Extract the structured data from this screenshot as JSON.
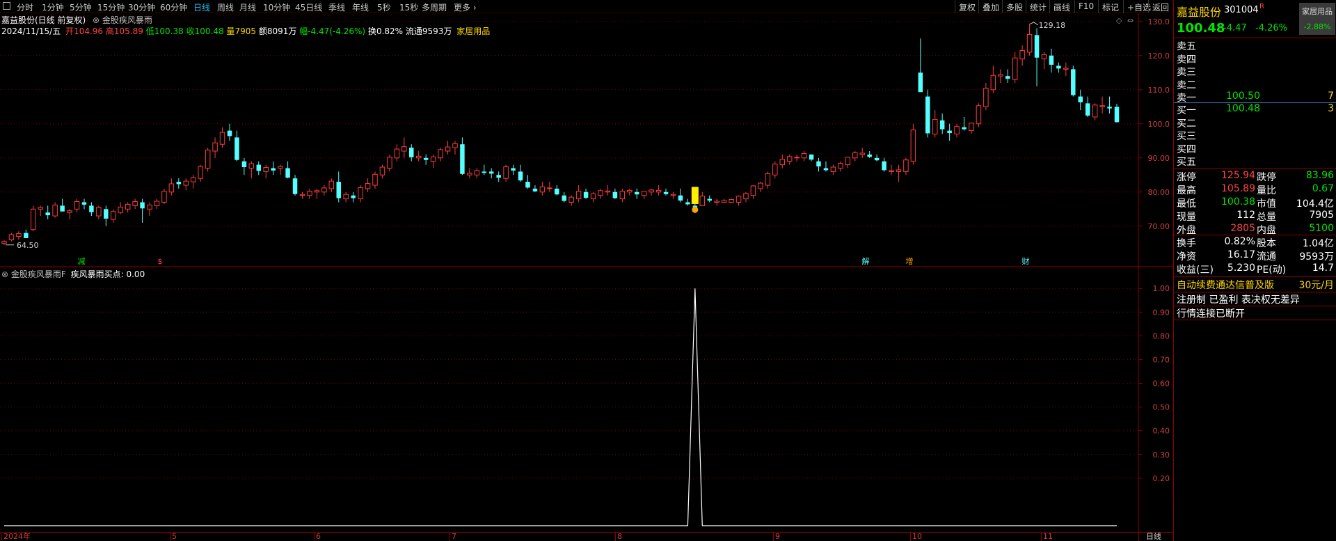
{
  "toolbar": {
    "periods": [
      "分时",
      "1分钟",
      "5分钟",
      "15分钟",
      "30分钟",
      "60分钟",
      "日线",
      "周线",
      "月线",
      "10分钟",
      "45日线",
      "季线",
      "年线",
      "5秒",
      "15秒",
      "多周期",
      "更多 ›"
    ],
    "active_period": "日线",
    "right_buttons": [
      "复权",
      "叠加",
      "多股",
      "统计",
      "画线",
      "F10",
      "标记",
      "+自选",
      "返回"
    ]
  },
  "info": {
    "title": "嘉益股份(日线 前复权)",
    "indicator_tag": "金股疾风暴雨",
    "date": "2024/11/15/五",
    "open_label": "开",
    "open": "104.96",
    "high_label": "高",
    "high": "105.89",
    "low_label": "低",
    "low": "100.38",
    "close_label": "收",
    "close": "100.48",
    "vol_label": "量",
    "vol": "7905",
    "amount_label": "额",
    "amount": "8091万",
    "chg_label": "幅",
    "chg": "-4.47(-4.26%)",
    "turnover_label": "换",
    "turnover": "0.82%",
    "float_label": "流通",
    "float": "9593万",
    "sector": "家居用品"
  },
  "main_chart": {
    "y_ticks": [
      "130.0",
      "120.0",
      "110.0",
      "100.0",
      "90.00",
      "80.00",
      "70.00"
    ],
    "y_range": [
      62,
      132
    ],
    "high_mark": "129.18",
    "low_mark": "64.50",
    "event_markers": [
      "减",
      "$",
      "解",
      "增",
      "财"
    ]
  },
  "indicator": {
    "name": "金股疾风暴雨F",
    "series_label": "疾风暴雨买点: 0.00",
    "y_ticks": [
      "1.00",
      "0.90",
      "0.80",
      "0.70",
      "0.60",
      "0.50",
      "0.40",
      "0.30",
      "0.20"
    ]
  },
  "time_axis": {
    "labels": [
      "2024年",
      "5",
      "6",
      "7",
      "8",
      "9",
      "10",
      "11"
    ],
    "period_tag": "日线"
  },
  "chart_data": {
    "type": "candlestick",
    "title": "嘉益股份(日线 前复权)",
    "candles": [
      [
        65,
        66,
        64.5,
        65.5
      ],
      [
        66,
        68,
        65.5,
        67.5
      ],
      [
        67,
        68.5,
        66,
        67.8
      ],
      [
        68,
        69,
        67,
        66.5
      ],
      [
        69,
        76,
        68.5,
        75
      ],
      [
        75,
        76,
        73,
        75.5
      ],
      [
        74,
        76,
        72,
        73.2
      ],
      [
        73,
        77,
        72.5,
        76.2
      ],
      [
        76,
        78,
        75,
        74.3
      ],
      [
        74,
        75,
        72,
        74.5
      ],
      [
        75,
        78,
        74,
        77.2
      ],
      [
        77,
        78,
        75,
        76.3
      ],
      [
        76,
        77,
        73,
        74.1
      ],
      [
        73,
        76,
        72,
        75.5
      ],
      [
        75,
        76,
        70,
        72.2
      ],
      [
        72,
        75,
        71,
        74.3
      ],
      [
        74,
        77,
        73.5,
        75.6
      ],
      [
        75,
        77,
        74,
        76.4
      ],
      [
        76,
        78,
        75,
        77.2
      ],
      [
        77,
        78,
        71,
        75.2
      ],
      [
        75,
        77,
        73,
        76.2
      ],
      [
        76,
        78,
        75,
        77.3
      ],
      [
        77,
        81,
        76.5,
        80.2
      ],
      [
        80,
        84,
        79,
        82.4
      ],
      [
        83,
        84,
        81,
        82.3
      ],
      [
        82,
        84,
        80.5,
        83.2
      ],
      [
        83,
        85,
        81,
        84.2
      ],
      [
        84,
        88,
        83,
        87.5
      ],
      [
        87,
        93,
        86,
        92.3
      ],
      [
        92,
        96,
        90,
        94.4
      ],
      [
        94,
        99,
        93,
        97.5
      ],
      [
        98,
        100,
        95,
        96.4
      ],
      [
        96,
        98,
        89,
        89.4
      ],
      [
        89,
        90,
        85,
        87.3
      ],
      [
        87,
        89,
        84,
        88.3
      ],
      [
        88,
        89,
        85,
        86.2
      ],
      [
        86,
        88,
        84,
        87.2
      ],
      [
        87,
        89,
        85,
        86.3
      ],
      [
        87,
        88,
        85,
        87.5
      ],
      [
        87,
        89,
        84,
        84.2
      ],
      [
        84,
        85,
        79,
        79.4
      ],
      [
        79,
        80,
        78,
        79.3
      ],
      [
        79,
        81,
        78,
        80.2
      ],
      [
        80,
        81,
        78,
        80.4
      ],
      [
        80,
        82,
        79,
        81.2
      ],
      [
        81,
        84,
        80,
        83.2
      ],
      [
        83,
        86,
        77,
        78.2
      ],
      [
        78,
        80,
        77,
        79.3
      ],
      [
        79,
        80,
        77,
        78.2
      ],
      [
        78,
        82,
        77,
        81.3
      ],
      [
        81,
        84,
        80,
        82.5
      ],
      [
        82,
        86,
        81,
        85.2
      ],
      [
        85,
        88,
        84,
        87.3
      ],
      [
        87,
        91,
        86,
        90.2
      ],
      [
        90,
        94,
        89,
        92.6
      ],
      [
        92,
        96,
        90,
        93.3
      ],
      [
        93,
        94,
        89,
        90.2
      ],
      [
        90,
        92,
        89,
        90.5
      ],
      [
        90,
        91,
        88,
        89.4
      ],
      [
        89,
        91,
        87,
        90.3
      ],
      [
        90,
        93,
        89,
        92.4
      ],
      [
        92,
        95,
        91,
        93.2
      ],
      [
        93,
        95,
        91,
        94.2
      ],
      [
        94,
        96,
        85,
        85.3
      ],
      [
        85,
        87,
        84,
        85.5
      ],
      [
        85,
        87,
        84,
        86.3
      ],
      [
        86,
        88,
        85,
        85.6
      ],
      [
        86,
        87,
        84,
        85.4
      ],
      [
        85,
        86,
        83,
        84.2
      ],
      [
        84,
        88,
        83,
        87.4
      ],
      [
        87,
        88,
        85,
        86.3
      ],
      [
        86,
        88,
        83,
        83.4
      ],
      [
        83,
        85,
        81,
        81.3
      ],
      [
        81,
        82,
        80,
        80.2
      ],
      [
        80,
        83,
        79,
        81.5
      ],
      [
        81,
        83,
        80,
        81.2
      ],
      [
        81,
        82,
        79,
        79.3
      ],
      [
        79,
        80,
        77,
        77.4
      ],
      [
        77,
        79,
        76,
        78.5
      ],
      [
        78,
        82,
        77,
        80.2
      ],
      [
        80,
        81,
        78,
        78.3
      ],
      [
        78,
        80,
        77,
        79.5
      ],
      [
        79,
        81,
        78,
        80.4
      ],
      [
        80,
        82,
        79,
        80.3
      ],
      [
        80,
        81,
        78,
        78.2
      ],
      [
        78,
        81,
        77,
        80.2
      ],
      [
        80,
        81,
        79,
        80.5
      ],
      [
        80,
        81,
        78,
        79.3
      ],
      [
        79,
        80,
        78,
        80.2
      ],
      [
        80,
        81,
        79,
        80.6
      ],
      [
        80,
        82,
        79,
        80.5
      ],
      [
        80,
        81,
        79,
        79.4
      ],
      [
        79,
        80,
        78,
        79.3
      ],
      [
        79,
        81,
        77,
        77.5
      ],
      [
        77,
        78,
        76,
        76.4
      ],
      [
        76,
        77,
        75,
        75.5
      ],
      [
        76,
        80,
        76,
        78.8
      ],
      [
        78,
        79,
        77,
        77.5
      ],
      [
        77,
        78,
        76,
        77.3
      ],
      [
        77,
        78,
        77,
        77.5
      ],
      [
        77,
        78,
        77,
        77.8
      ],
      [
        77,
        79,
        76,
        78.8
      ],
      [
        78,
        80,
        77,
        79.6
      ],
      [
        79,
        82,
        78,
        81.8
      ],
      [
        81,
        83,
        80,
        82.6
      ],
      [
        82,
        86,
        81,
        85.4
      ],
      [
        85,
        89,
        84,
        88.2
      ],
      [
        88,
        91,
        87,
        89.6
      ],
      [
        89,
        91,
        88,
        90.4
      ],
      [
        90,
        91,
        89,
        90.2
      ],
      [
        90,
        92,
        89,
        91.3
      ],
      [
        91,
        91,
        89,
        89.5
      ],
      [
        89,
        90,
        86,
        87.5
      ],
      [
        87,
        89,
        86,
        86.4
      ],
      [
        86,
        88,
        85,
        87.3
      ],
      [
        87,
        89,
        86,
        88.4
      ],
      [
        88,
        90,
        87,
        90.2
      ],
      [
        90,
        92,
        89,
        91.5
      ],
      [
        91,
        93,
        90,
        91.4
      ],
      [
        91,
        92,
        90,
        90.3
      ],
      [
        90,
        91,
        89,
        89.3
      ],
      [
        89,
        90,
        86,
        86.4
      ],
      [
        86,
        88,
        85,
        86.3
      ],
      [
        86,
        88,
        83,
        86.5
      ],
      [
        86,
        90,
        85,
        89.4
      ],
      [
        89,
        100,
        88,
        98.2
      ],
      [
        115,
        125,
        110,
        109.3
      ],
      [
        108,
        110,
        96,
        97.2
      ],
      [
        97,
        104,
        96,
        101.3
      ],
      [
        101,
        103,
        97,
        98.4
      ],
      [
        98,
        100,
        95,
        97.3
      ],
      [
        97,
        100,
        96,
        99.2
      ],
      [
        99,
        102,
        98,
        98.4
      ],
      [
        98,
        100,
        97,
        100.2
      ],
      [
        100,
        106,
        99,
        105.3
      ],
      [
        105,
        112,
        104,
        110.4
      ],
      [
        110,
        117,
        109,
        114.2
      ],
      [
        114,
        116,
        112,
        114.4
      ],
      [
        114,
        116,
        112,
        113.2
      ],
      [
        113,
        121,
        112,
        119.3
      ],
      [
        119,
        123,
        117,
        121.5
      ],
      [
        121,
        129.18,
        120,
        126.2
      ],
      [
        126,
        128,
        111,
        119.4
      ],
      [
        119,
        121,
        116,
        120.3
      ],
      [
        120,
        122,
        115,
        117.3
      ],
      [
        117,
        118,
        115,
        116.2
      ],
      [
        116,
        118,
        114,
        116.3
      ],
      [
        116,
        117,
        108,
        108.4
      ],
      [
        108,
        110,
        104,
        106.3
      ],
      [
        106,
        108,
        102,
        102.4
      ],
      [
        102,
        106,
        101,
        105.5
      ],
      [
        105,
        108,
        103,
        105.3
      ],
      [
        105,
        108,
        103,
        104.5
      ],
      [
        104.96,
        105.89,
        100.38,
        100.48
      ]
    ],
    "indicator_series": {
      "name": "疾风暴雨买点",
      "spike_index": 95,
      "spike_value": 1.0,
      "current": 0.0
    }
  },
  "right_panel": {
    "name": "嘉益股份",
    "code": "301004",
    "code_flag": "R",
    "sector": "家居用品",
    "sector_chg": "-2.88%",
    "price": "100.48",
    "chg": "-4.47",
    "chg_pct": "-4.26%",
    "asks": [
      {
        "label": "卖五",
        "price": "",
        "vol": ""
      },
      {
        "label": "卖四",
        "price": "",
        "vol": ""
      },
      {
        "label": "卖三",
        "price": "",
        "vol": ""
      },
      {
        "label": "卖二",
        "price": "",
        "vol": ""
      },
      {
        "label": "卖一",
        "price": "100.50",
        "vol": "7"
      }
    ],
    "bids": [
      {
        "label": "买一",
        "price": "100.48",
        "vol": "3"
      },
      {
        "label": "买二",
        "price": "",
        "vol": ""
      },
      {
        "label": "买三",
        "price": "",
        "vol": ""
      },
      {
        "label": "买四",
        "price": "",
        "vol": ""
      },
      {
        "label": "买五",
        "price": "",
        "vol": ""
      }
    ],
    "stats": [
      {
        "l1": "涨停",
        "v1": "125.94",
        "l2": "跌停",
        "v2": "83.96"
      },
      {
        "l1": "最高",
        "v1": "105.89",
        "l2": "量比",
        "v2": "0.67"
      },
      {
        "l1": "最低",
        "v1": "100.38",
        "l2": "市值",
        "v2": "104.4亿"
      },
      {
        "l1": "现量",
        "v1": "112",
        "l2": "总量",
        "v2": "7905"
      },
      {
        "l1": "外盘",
        "v1": "2805",
        "l2": "内盘",
        "v2": "5100"
      }
    ],
    "fund": [
      {
        "l1": "换手",
        "v1": "0.82%",
        "l2": "股本",
        "v2": "1.04亿"
      },
      {
        "l1": "净资",
        "v1": "16.17",
        "l2": "流通",
        "v2": "9593万"
      },
      {
        "l1": "收益(三)",
        "v1": "5.230",
        "l2": "PE(动)",
        "v2": "14.7"
      }
    ],
    "notice1": "自动续费通达信普及版",
    "notice1_price": "30元/月",
    "notice2": "注册制 已盈利 表决权无差异",
    "notice3": "行情连接已断开"
  }
}
